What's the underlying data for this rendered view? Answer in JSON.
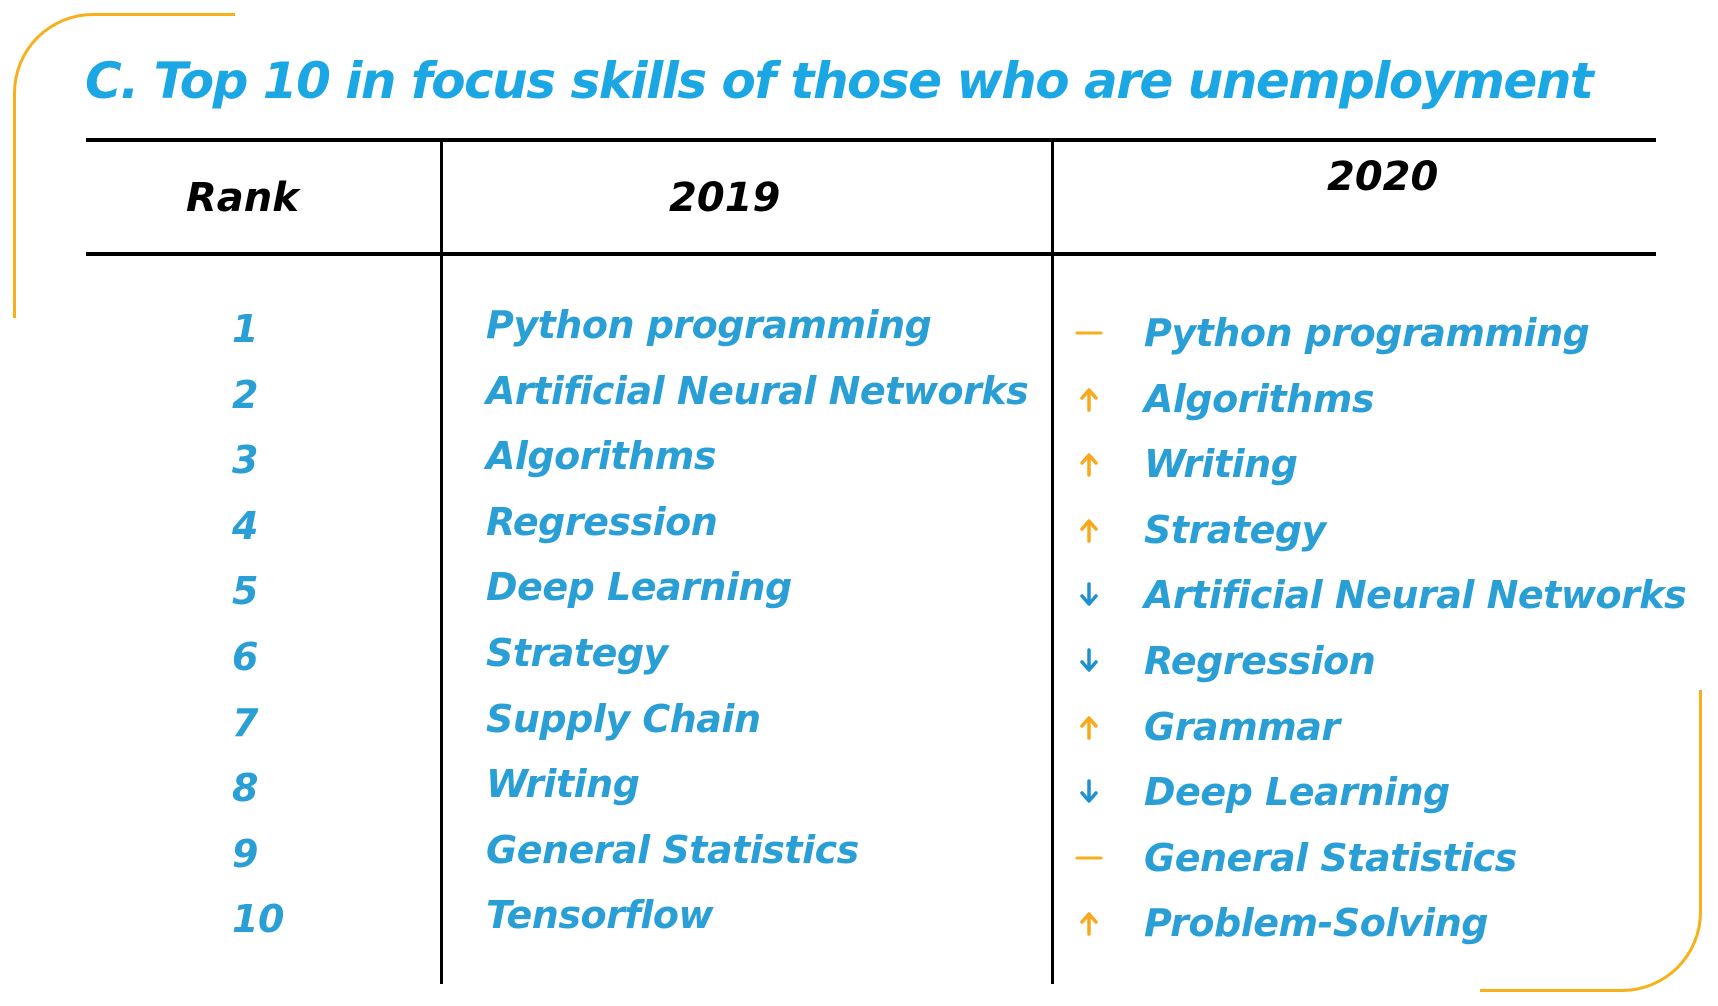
{
  "title": "C. Top 10 in focus skills of those who are unemployment",
  "headers": {
    "rank": "Rank",
    "year_2019": "2019",
    "year_2020": "2020"
  },
  "colors": {
    "accent_blue": "#1aa7e3",
    "row_blue": "#2a9fd6",
    "orange": "#f7b01c",
    "up_arrow": "#f7a81b",
    "down_arrow": "#1f8fce",
    "same_dash": "#f7b01c"
  },
  "rows": [
    {
      "rank": "1",
      "skill_2019": "Python programming",
      "skill_2020": "Python programming",
      "trend_2020": "same"
    },
    {
      "rank": "2",
      "skill_2019": "Artificial Neural Networks",
      "skill_2020": "Algorithms",
      "trend_2020": "up"
    },
    {
      "rank": "3",
      "skill_2019": "Algorithms",
      "skill_2020": "Writing",
      "trend_2020": "up"
    },
    {
      "rank": "4",
      "skill_2019": "Regression",
      "skill_2020": "Strategy",
      "trend_2020": "up"
    },
    {
      "rank": "5",
      "skill_2019": "Deep Learning",
      "skill_2020": "Artificial Neural Networks",
      "trend_2020": "down"
    },
    {
      "rank": "6",
      "skill_2019": "Strategy",
      "skill_2020": "Regression",
      "trend_2020": "down"
    },
    {
      "rank": "7",
      "skill_2019": "Supply Chain",
      "skill_2020": "Grammar",
      "trend_2020": "up"
    },
    {
      "rank": "8",
      "skill_2019": "Writing",
      "skill_2020": "Deep Learning",
      "trend_2020": "down"
    },
    {
      "rank": "9",
      "skill_2019": "General Statistics",
      "skill_2020": "General Statistics",
      "trend_2020": "same"
    },
    {
      "rank": "10",
      "skill_2019": "Tensorflow",
      "skill_2020": "Problem-Solving",
      "trend_2020": "up"
    }
  ]
}
